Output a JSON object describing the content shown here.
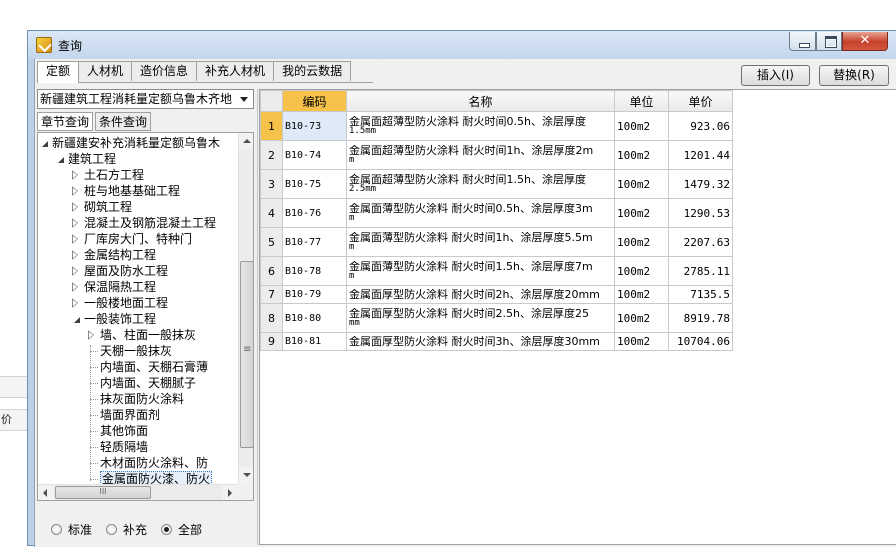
{
  "window": {
    "title": "查询"
  },
  "background_rows": [
    "",
    "价"
  ],
  "tabs": [
    {
      "label": "定额",
      "active": true
    },
    {
      "label": "人材机",
      "active": false
    },
    {
      "label": "造价信息",
      "active": false
    },
    {
      "label": "补充人材机",
      "active": false
    },
    {
      "label": "我的云数据",
      "active": false
    }
  ],
  "toolbar": {
    "insert_label": "插入(I)",
    "replace_label": "替换(R)"
  },
  "left": {
    "selected_library": "新疆建筑工程消耗量定额乌鲁木齐地",
    "subtabs": [
      {
        "label": "章节查询",
        "active": true
      },
      {
        "label": "条件查询",
        "active": false
      }
    ],
    "tree": [
      {
        "label": "新疆建安补充消耗量定额乌鲁木",
        "level": 0,
        "state": "open"
      },
      {
        "label": "建筑工程",
        "level": 1,
        "state": "open"
      },
      {
        "label": "土石方工程",
        "level": 2,
        "state": "closed"
      },
      {
        "label": "桩与地基基础工程",
        "level": 2,
        "state": "closed"
      },
      {
        "label": "砌筑工程",
        "level": 2,
        "state": "closed"
      },
      {
        "label": "混凝土及钢筋混凝土工程",
        "level": 2,
        "state": "closed"
      },
      {
        "label": "厂库房大门、特种门",
        "level": 2,
        "state": "closed"
      },
      {
        "label": "金属结构工程",
        "level": 2,
        "state": "closed"
      },
      {
        "label": "屋面及防水工程",
        "level": 2,
        "state": "closed"
      },
      {
        "label": "保温隔热工程",
        "level": 2,
        "state": "closed"
      },
      {
        "label": "一般楼地面工程",
        "level": 2,
        "state": "closed"
      },
      {
        "label": "一般装饰工程",
        "level": 2,
        "state": "open"
      },
      {
        "label": "墙、柱面一般抹灰",
        "level": 3,
        "state": "closed"
      },
      {
        "label": "天棚一般抹灰",
        "level": 3,
        "state": "leaf"
      },
      {
        "label": "内墙面、天棚石膏薄",
        "level": 3,
        "state": "leaf"
      },
      {
        "label": "内墙面、天棚腻子",
        "level": 3,
        "state": "leaf"
      },
      {
        "label": "抹灰面防火涂料",
        "level": 3,
        "state": "leaf"
      },
      {
        "label": "墙面界面剂",
        "level": 3,
        "state": "leaf"
      },
      {
        "label": "其他饰面",
        "level": 3,
        "state": "leaf"
      },
      {
        "label": "轻质隔墙",
        "level": 3,
        "state": "leaf"
      },
      {
        "label": "木材面防火涂料、防",
        "level": 3,
        "state": "leaf"
      },
      {
        "label": "金属面防火漆、防火",
        "level": 3,
        "state": "leaf",
        "selected": true
      }
    ],
    "hscroll_grip": "III",
    "radios": [
      {
        "label": "标准",
        "checked": false
      },
      {
        "label": "补充",
        "checked": false
      },
      {
        "label": "全部",
        "checked": true
      }
    ]
  },
  "grid": {
    "columns": [
      "编码",
      "名称",
      "单位",
      "单价"
    ],
    "rows": [
      {
        "n": "1",
        "code": "B10-73",
        "name1": "金属面超薄型防火涂料 耐火时间0.5h、涂层厚度",
        "name2": "1.5mm",
        "unit": "100m2",
        "price": "923.06"
      },
      {
        "n": "2",
        "code": "B10-74",
        "name1": "金属面超薄型防火涂料 耐火时间1h、涂层厚度2m",
        "name2": "m",
        "unit": "100m2",
        "price": "1201.44"
      },
      {
        "n": "3",
        "code": "B10-75",
        "name1": "金属面超薄型防火涂料 耐火时间1.5h、涂层厚度",
        "name2": "2.5mm",
        "unit": "100m2",
        "price": "1479.32"
      },
      {
        "n": "4",
        "code": "B10-76",
        "name1": "金属面薄型防火涂料 耐火时间0.5h、涂层厚度3m",
        "name2": "m",
        "unit": "100m2",
        "price": "1290.53"
      },
      {
        "n": "5",
        "code": "B10-77",
        "name1": "金属面薄型防火涂料 耐火时间1h、涂层厚度5.5m",
        "name2": "m",
        "unit": "100m2",
        "price": "2207.63"
      },
      {
        "n": "6",
        "code": "B10-78",
        "name1": "金属面薄型防火涂料 耐火时间1.5h、涂层厚度7m",
        "name2": "m",
        "unit": "100m2",
        "price": "2785.11"
      },
      {
        "n": "7",
        "code": "B10-79",
        "name1": "金属面厚型防火涂料 耐火时间2h、涂层厚度20mm",
        "name2": "",
        "unit": "100m2",
        "price": "7135.5"
      },
      {
        "n": "8",
        "code": "B10-80",
        "name1": "金属面厚型防火涂料 耐火时间2.5h、涂层厚度25",
        "name2": "mm",
        "unit": "100m2",
        "price": "8919.78"
      },
      {
        "n": "9",
        "code": "B10-81",
        "name1": "金属面厚型防火涂料 耐火时间3h、涂层厚度30mm",
        "name2": "",
        "unit": "100m2",
        "price": "10704.06"
      }
    ]
  }
}
